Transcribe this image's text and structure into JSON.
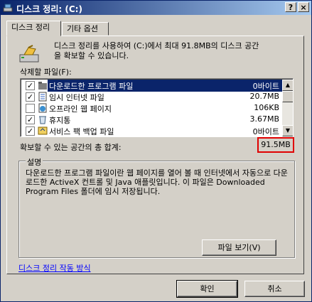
{
  "window": {
    "title": "디스크 정리: (C:)"
  },
  "tabs": [
    {
      "label": "디스크 정리"
    },
    {
      "label": "기타 옵션"
    }
  ],
  "intro": {
    "line1": "디스크 정리를 사용하여 (C:)에서 최대 91.8MB의 디스크 공간",
    "line2": "을 확보할 수 있습니다."
  },
  "files_label": "삭제할 파일(F):",
  "files": [
    {
      "checked": true,
      "name": "다운로드한 프로그램 파일",
      "size": "0바이트",
      "icon": "folder-icon",
      "selected": true
    },
    {
      "checked": true,
      "name": "임시 인터넷 파일",
      "size": "20.7MB",
      "icon": "document-icon",
      "selected": false
    },
    {
      "checked": false,
      "name": "오프라인 웹 페이지",
      "size": "106KB",
      "icon": "offline-page-icon",
      "selected": false
    },
    {
      "checked": true,
      "name": "휴지통",
      "size": "3.67MB",
      "icon": "recycle-bin-icon",
      "selected": false
    },
    {
      "checked": true,
      "name": "서비스 팩 백업 파일",
      "size": "0바이트",
      "icon": "backup-icon",
      "selected": false
    }
  ],
  "total": {
    "label": "확보할 수 있는 공간의 총 합계:",
    "value": "91.5MB"
  },
  "description": {
    "legend": "설명",
    "text": "다운로드한 프로그램 파일이란 웹 페이지를 열어 볼 때 인터넷에서 자동으로 다운로드한 ActiveX 컨트롤 및 Java 애플릿입니다. 이 파일은 Downloaded Program Files 폴더에 임시 저장됩니다."
  },
  "view_files_button": "파일 보기(V)",
  "help_link": "디스크 정리 작동 방식",
  "ok_button": "확인",
  "cancel_button": "취소",
  "titlebar_buttons": {
    "help": "?",
    "close": "×"
  }
}
